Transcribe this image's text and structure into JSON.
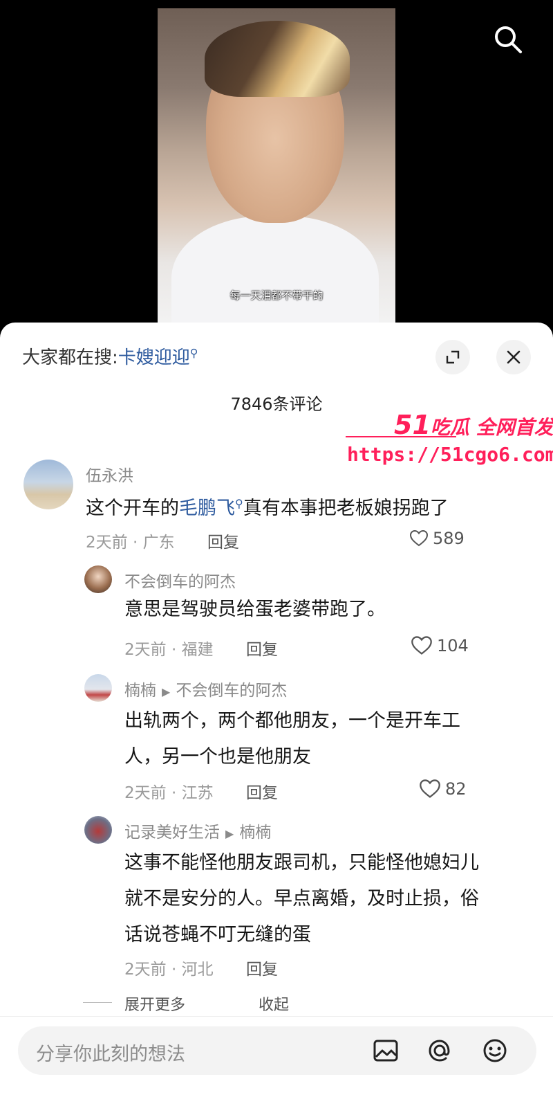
{
  "video": {
    "caption": "每一天泪都不带干的"
  },
  "sheet": {
    "hot_search_prefix": "大家都在搜:",
    "hot_search_keyword": "卡嫂迎迎",
    "comment_count": "7846条评论"
  },
  "watermark": {
    "num": "51",
    "title": "吃瓜 全网首发",
    "url": "https://51cgo6.com"
  },
  "comments": [
    {
      "user": "伍永洪",
      "text_before": "这个开车的",
      "mention": "毛鹏飞",
      "text_after": "真有本事把老板娘拐跑了",
      "meta": "2天前 · 广东",
      "reply": "回复",
      "likes": "589"
    },
    {
      "user": "不会倒车的阿杰",
      "text": "意思是驾驶员给蛋老婆带跑了。",
      "meta": "2天前 · 福建",
      "reply": "回复",
      "likes": "104"
    },
    {
      "user": "楠楠",
      "reply_to": "不会倒车的阿杰",
      "text_line1": "出轨两个，两个都他朋友，一个是开车工",
      "text_line2": "人，另一个也是他朋友",
      "meta": "2天前 · 江苏",
      "reply": "回复",
      "likes": "82"
    },
    {
      "user": "记录美好生活",
      "reply_to": "楠楠",
      "text_line1": "这事不能怪他朋友跟司机，只能怪他媳妇儿",
      "text_line2": "就不是安分的人。早点离婚，及时止损，俗",
      "text_line3": "话说苍蝇不叮无缝的蛋",
      "meta": "2天前 · 河北",
      "reply": "回复"
    }
  ],
  "footer_actions": {
    "expand_more": "展开更多",
    "collapse": "收起"
  },
  "input": {
    "placeholder": "分享你此刻的想法"
  },
  "icons": [
    "search-icon",
    "expand-icon",
    "close-icon",
    "heart-icon",
    "image-icon",
    "at-icon",
    "emoji-icon"
  ],
  "colors": {
    "mention": "#2d5a9e",
    "watermark": "#ff1f5a"
  }
}
